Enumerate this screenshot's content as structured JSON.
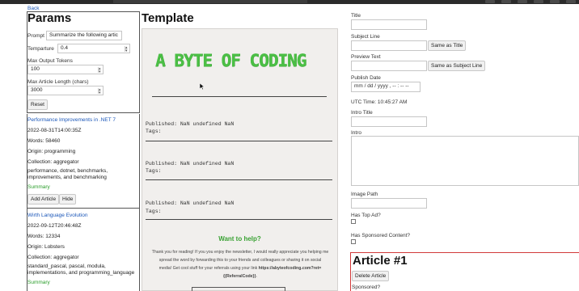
{
  "nav": {
    "back_label": "Back"
  },
  "params": {
    "title": "Params",
    "prompt_label": "Prompt",
    "prompt_value": "Summarize the following artic",
    "temperature_label": "Temparture",
    "temperature_value": "0.4",
    "max_output_label": "Max Output Tokens",
    "max_output_value": "100",
    "max_article_label": "Max Article Length (chars)",
    "max_article_value": "3000",
    "reset_label": "Reset"
  },
  "articles": [
    {
      "title": "Performance Improvements in .NET 7",
      "date": "2022-08-31T14:00:35Z",
      "words": "Words: 58460",
      "origin": "Origin: programming",
      "collection": "Collection: aggregator",
      "tags": "performance, dotnet, benchmarks, improvements, and benchmarking",
      "summary_label": "Summary",
      "add_label": "Add Article",
      "hide_label": "Hide"
    },
    {
      "title": "Wirth Language Evolution",
      "date": "2022-09-12T20:46:48Z",
      "words": "Words: 12334",
      "origin": "Origin: Lobsters",
      "collection": "Collection: aggregator",
      "tags": "standard_pascal, pascal, modula, implementations, and programming_language",
      "summary_label": "Summary"
    }
  ],
  "template": {
    "title": "Template",
    "logo_text": "A BYTE OF CODING",
    "entries": [
      {
        "published": "Published: NaN undefined NaN",
        "tags": "Tags:"
      },
      {
        "published": "Published: NaN undefined NaN",
        "tags": "Tags:"
      },
      {
        "published": "Published: NaN undefined NaN",
        "tags": "Tags:"
      }
    ],
    "want_help": "Want to help?",
    "footer_line1": "Thank you for reading! If you you enjoy the newsletter, I would really appreciate you helping me",
    "footer_line2": "spread the word by forwarding this to your friends and colleagues or sharing it on social",
    "footer_line3_pre": "media! Get cool stuff for your referrals using your link ",
    "footer_line3_link": "https://abyteofcoding.com?ret=",
    "footer_line4": "{{ReferralCode}}",
    "footer_line4_end": "."
  },
  "form": {
    "title_label": "Title",
    "subject_label": "Subject Line",
    "same_as_title": "Same as Title",
    "preview_label": "Preview Text",
    "same_as_subject": "Same as Subject Line",
    "publish_label": "Publish Date",
    "publish_placeholder": "mm / dd / yyyy ,  -- : --   --",
    "utc_time": "UTC Time: 10:45:27 AM",
    "intro_title_label": "Intro Title",
    "intro_label": "Intro",
    "image_path_label": "Image Path",
    "top_ad_label": "Has Top Ad?",
    "sponsored_label": "Has Sponsored Content?",
    "article_heading": "Article #1",
    "delete_label": "Delete Article",
    "sponsored_q": "Sponsored?"
  },
  "colors": {
    "accent_green": "#3aa234",
    "link_blue": "#1a56b8",
    "danger_red": "#d23a3a"
  }
}
